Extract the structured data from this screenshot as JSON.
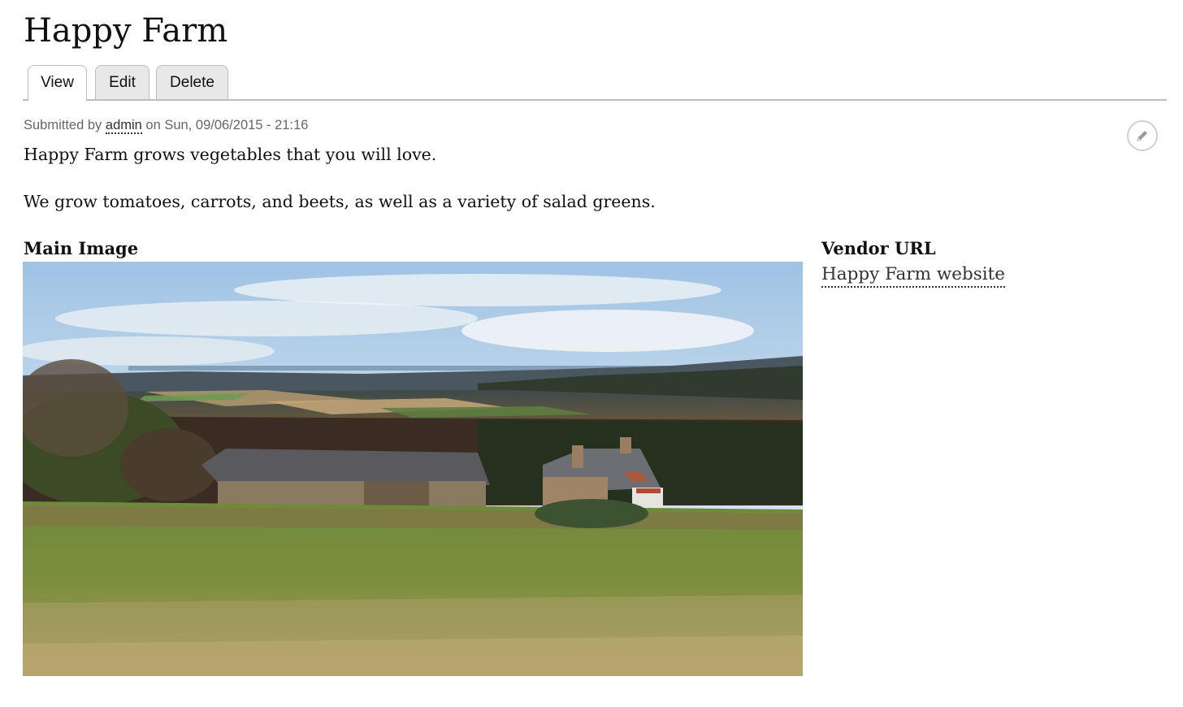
{
  "page": {
    "title": "Happy Farm"
  },
  "tabs": [
    {
      "label": "View",
      "active": true
    },
    {
      "label": "Edit",
      "active": false
    },
    {
      "label": "Delete",
      "active": false
    }
  ],
  "meta": {
    "prefix": "Submitted by ",
    "author": "admin",
    "suffix": " on Sun, 09/06/2015 - 21:16"
  },
  "body": {
    "paragraphs": [
      "Happy Farm grows vegetables that you will love.",
      "We grow tomatoes, carrots, and beets, as well as a variety of salad greens."
    ]
  },
  "fields": {
    "main_image_label": "Main Image",
    "vendor_url_label": "Vendor URL",
    "vendor_link_text": "Happy Farm website"
  },
  "icons": {
    "edit": "pencil-icon"
  },
  "colors": {
    "link": "#333333",
    "tab_bg": "#e8e8e8",
    "tab_border": "#bdbdbd",
    "meta_text": "#666666"
  }
}
